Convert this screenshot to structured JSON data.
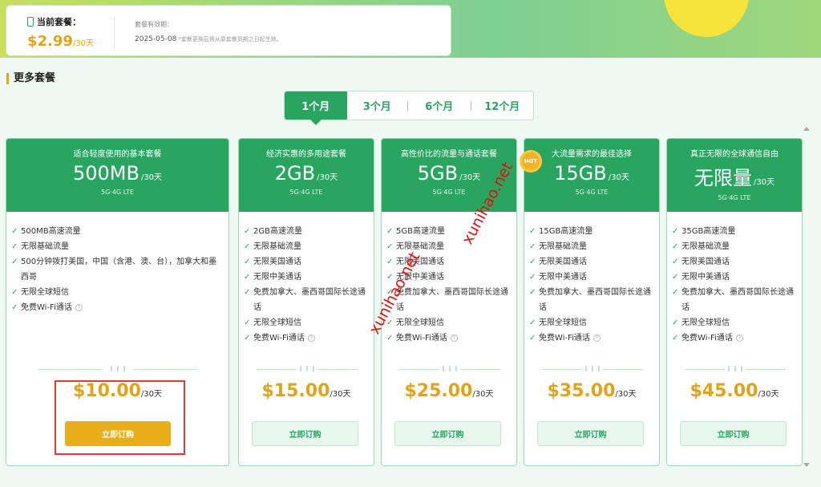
{
  "current_plan": {
    "label": "当前套餐：",
    "price": "$2.99",
    "period": "/30天",
    "expiry_label": "套餐有效期：",
    "expiry_date": "2025-05-08",
    "expiry_note": "*套餐更换后将从原套餐到期之日起生效。"
  },
  "section_title": "更多套餐",
  "tabs": [
    {
      "label": "1个月",
      "active": true
    },
    {
      "label": "3个月",
      "active": false
    },
    {
      "label": "6个月",
      "active": false
    },
    {
      "label": "12个月",
      "active": false
    }
  ],
  "hot_badge": "HOT",
  "plans": [
    {
      "subtitle": "适合轻度使用的基本套餐",
      "size": "500MB",
      "size_period": "/30天",
      "network": "5G·4G LTE",
      "features": [
        "500MB高速流量",
        "无限基础流量",
        "500分钟拨打美国，中国（含港、澳、台），加拿大和墨西哥",
        "无限全球短信",
        "免费Wi-Fi通话"
      ],
      "price": "$10.00",
      "price_period": "/30天",
      "button": "立即订购"
    },
    {
      "subtitle": "经济实惠的多用途套餐",
      "size": "2GB",
      "size_period": "/30天",
      "network": "5G·4G LTE",
      "features": [
        "2GB高速流量",
        "无限基础流量",
        "无限美国通话",
        "无限中美通话",
        "免费加拿大、墨西哥国际长途通话",
        "无限全球短信",
        "免费Wi-Fi通话"
      ],
      "price": "$15.00",
      "price_period": "/30天",
      "button": "立即订购"
    },
    {
      "subtitle": "高性价比的流量与通话套餐",
      "size": "5GB",
      "size_period": "/30天",
      "network": "5G·4G LTE",
      "features": [
        "5GB高速流量",
        "无限基础流量",
        "无限美国通话",
        "无限中美通话",
        "免费加拿大、墨西哥国际长途通话",
        "无限全球短信",
        "免费Wi-Fi通话"
      ],
      "price": "$25.00",
      "price_period": "/30天",
      "button": "立即订购"
    },
    {
      "subtitle": "大流量需求的最佳选择",
      "size": "15GB",
      "size_period": "/30天",
      "network": "5G·4G LTE",
      "features": [
        "15GB高速流量",
        "无限基础流量",
        "无限美国通话",
        "无限中美通话",
        "免费加拿大、墨西哥国际长途通话",
        "无限全球短信",
        "免费Wi-Fi通话"
      ],
      "price": "$35.00",
      "price_period": "/30天",
      "button": "立即订购"
    },
    {
      "subtitle": "真正无限的全球通信自由",
      "size": "无限量",
      "size_period": "/30天",
      "network": "5G·4G LTE",
      "features": [
        "35GB高速流量",
        "无限基础流量",
        "无限美国通话",
        "无限中美通话",
        "免费加拿大、墨西哥国际长途通话",
        "无限全球短信",
        "免费Wi-Fi通话"
      ],
      "price": "$45.00",
      "price_period": "/30天",
      "button": "立即订购"
    }
  ],
  "watermarks": [
    "xunihao.net",
    "xunihao.net"
  ]
}
